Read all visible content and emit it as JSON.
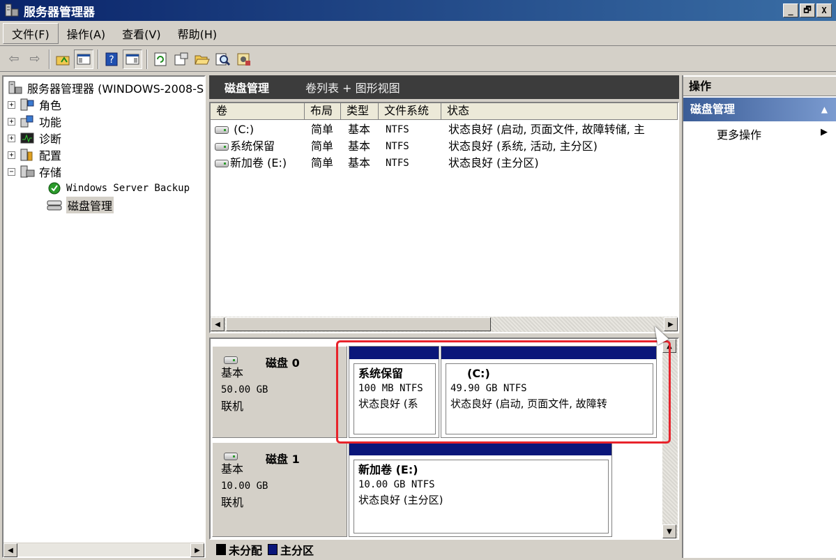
{
  "window": {
    "title": "服务器管理器",
    "btn_min": "_",
    "btn_max": "🗗",
    "btn_close": "X"
  },
  "menu": {
    "file": "文件(F)",
    "action": "操作(A)",
    "view": "查看(V)",
    "help": "帮助(H)"
  },
  "toolbar": {
    "back": "⇦",
    "forward": "⇨",
    "up": "📁",
    "show_tree": "▤",
    "help": "?",
    "show_pane": "▤",
    "refresh": "⟳",
    "properties": "📋",
    "open": "📂",
    "search": "🔍",
    "settings": "⚙"
  },
  "tree": {
    "root": "服务器管理器 (WINDOWS-2008-S",
    "roles": "角色",
    "features": "功能",
    "diagnostics": "诊断",
    "config": "配置",
    "storage": "存储",
    "backup": "Windows Server Backup",
    "disk_mgmt": "磁盘管理"
  },
  "center": {
    "title": "磁盘管理",
    "subtitle": "卷列表 + 图形视图",
    "columns": [
      "卷",
      "布局",
      "类型",
      "文件系统",
      "状态"
    ],
    "volumes": [
      {
        "name": "(C:)",
        "layout": "简单",
        "type": "基本",
        "fs": "NTFS",
        "status": "状态良好 (启动, 页面文件, 故障转储, 主"
      },
      {
        "name": "系统保留",
        "layout": "简单",
        "type": "基本",
        "fs": "NTFS",
        "status": "状态良好 (系统, 活动, 主分区)"
      },
      {
        "name": "新加卷 (E:)",
        "layout": "简单",
        "type": "基本",
        "fs": "NTFS",
        "status": "状态良好 (主分区)"
      }
    ]
  },
  "disks": [
    {
      "name": "磁盘 0",
      "kind": "基本",
      "size": "50.00 GB",
      "state": "联机",
      "partitions": [
        {
          "name": "系统保留",
          "size": "100 MB NTFS",
          "status": "状态良好 (系"
        },
        {
          "name": "(C:)",
          "size": "49.90 GB NTFS",
          "status": "状态良好 (启动, 页面文件, 故障转"
        }
      ]
    },
    {
      "name": "磁盘 1",
      "kind": "基本",
      "size": "10.00 GB",
      "state": "联机",
      "partitions": [
        {
          "name": "新加卷 (E:)",
          "size": "10.00 GB NTFS",
          "status": "状态良好 (主分区)"
        }
      ]
    }
  ],
  "legend": {
    "unallocated": "未分配",
    "primary": "主分区",
    "unallocated_color": "#000000",
    "primary_color": "#0a167a"
  },
  "actions": {
    "title": "操作",
    "section": "磁盘管理",
    "more": "更多操作"
  },
  "colors": {
    "highlight": "#e8232b",
    "partition_bar": "#0a167a"
  }
}
